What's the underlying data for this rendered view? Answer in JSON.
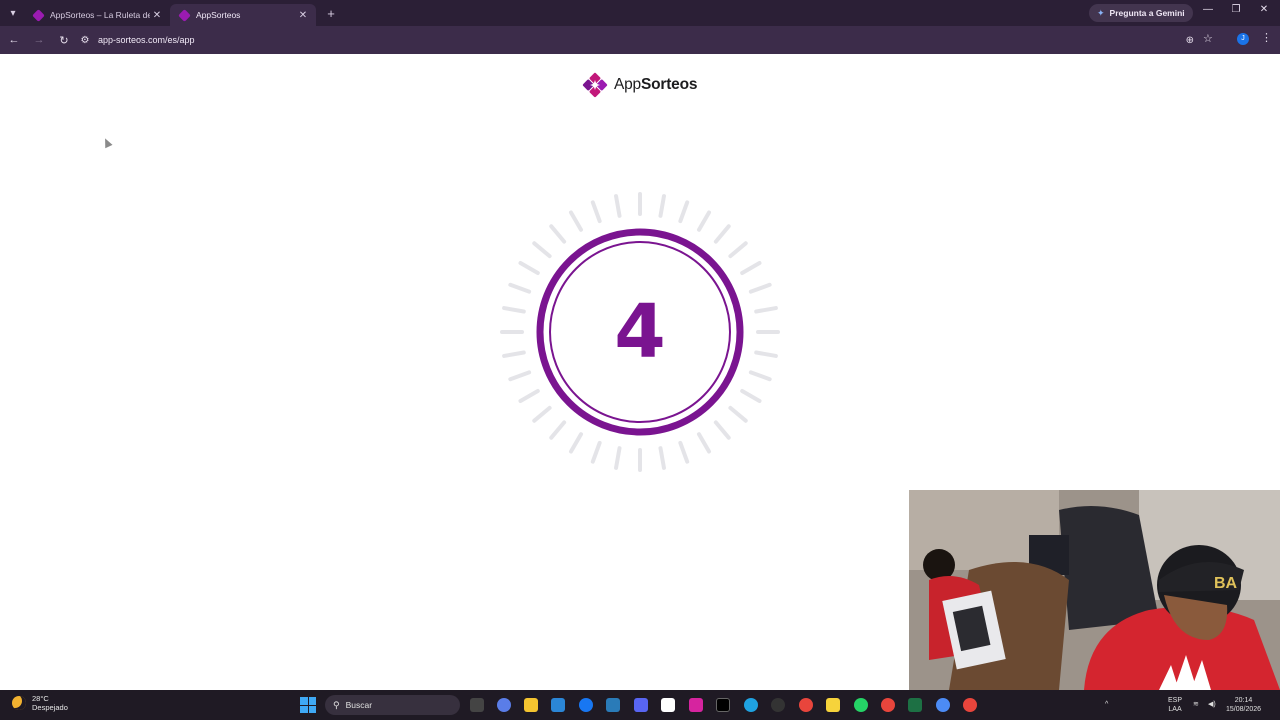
{
  "browser": {
    "tabs": [
      {
        "title": "AppSorteos – La Ruleta de la Su",
        "active": false
      },
      {
        "title": "AppSorteos",
        "active": true
      }
    ],
    "gemini_label": "Pregunta a Gemini",
    "url": "app-sorteos.com/es/app",
    "profile_initial": "J"
  },
  "page": {
    "logo_text_light": "App",
    "logo_text_bold": "Sorteos",
    "countdown_value": "4"
  },
  "colors": {
    "brand_purple": "#7a1490",
    "brand_magenta": "#c2187a"
  },
  "taskbar": {
    "temperature": "28°C",
    "weather": "Despejado",
    "search_placeholder": "Buscar",
    "lang_top": "ESP",
    "lang_bottom": "LAA",
    "time": "20:14",
    "date": "15/08/2026"
  }
}
